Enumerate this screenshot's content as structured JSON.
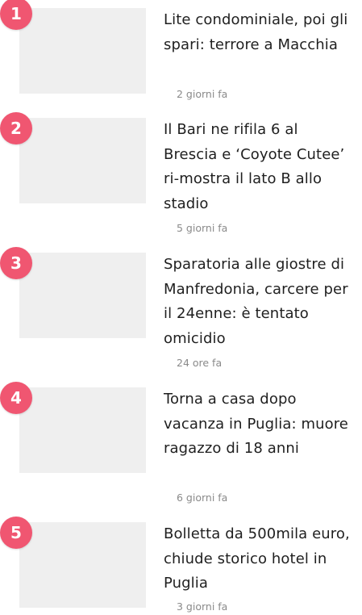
{
  "articles": [
    {
      "rank": "1",
      "title": "Lite condominiale, poi gli spari: terrore a Macchia",
      "time": "2 giorni fa"
    },
    {
      "rank": "2",
      "title": "Il Bari ne rifila 6 al Brescia e ‘Coyote Cutee’ ri-mostra il lato B allo stadio",
      "time": "5 giorni fa"
    },
    {
      "rank": "3",
      "title": "Sparatoria alle giostre di Manfredonia, carcere per il 24enne: è tentato omicidio",
      "time": "24 ore fa"
    },
    {
      "rank": "4",
      "title": "Torna a casa dopo vacanza in Puglia: muore ragazzo di 18 anni",
      "time": "6 giorni fa"
    },
    {
      "rank": "5",
      "title": "Bolletta da 500mila euro, chiude storico hotel in Puglia",
      "time": "3 giorni fa"
    }
  ],
  "colors": {
    "badge": "#f05671",
    "thumbnail_placeholder": "#efefef",
    "title": "#1f1f1f",
    "time": "#8a8a8a"
  }
}
